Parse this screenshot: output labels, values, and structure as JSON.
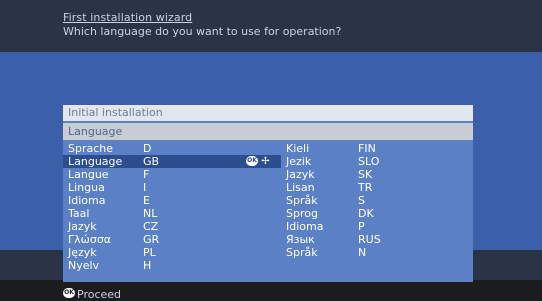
{
  "wizard": {
    "title": "First installation wizard",
    "question": "Which language do you want to use for operation?"
  },
  "panel": {
    "title": "Initial installation",
    "subtitle": "Language",
    "selected_index": 1,
    "left_items": [
      {
        "label": "Sprache",
        "code": "D"
      },
      {
        "label": "Language",
        "code": "GB"
      },
      {
        "label": "Langue",
        "code": "F"
      },
      {
        "label": "Lingua",
        "code": "I"
      },
      {
        "label": "Idioma",
        "code": "E"
      },
      {
        "label": "Taal",
        "code": "NL"
      },
      {
        "label": "Jazyk",
        "code": "CZ"
      },
      {
        "label": "Γλώσσα",
        "code": "GR"
      },
      {
        "label": "Język",
        "code": "PL"
      },
      {
        "label": "Nyelv",
        "code": "H"
      }
    ],
    "right_items": [
      {
        "label": "Kieli",
        "code": "FIN"
      },
      {
        "label": "Jezik",
        "code": "SLO"
      },
      {
        "label": "Jazyk",
        "code": "SK"
      },
      {
        "label": "Lisan",
        "code": "TR"
      },
      {
        "label": "Språk",
        "code": "S"
      },
      {
        "label": "Sprog",
        "code": "DK"
      },
      {
        "label": "Idioma",
        "code": "P"
      },
      {
        "label": "Язык",
        "code": "RUS"
      },
      {
        "label": "Språk",
        "code": "N"
      }
    ],
    "ok_badge": "OK",
    "nav_icon": "dpad-arrows-icon"
  },
  "footer": {
    "ok_badge": "OK",
    "proceed_label": "Proceed"
  },
  "colors": {
    "header_bg": "#2b3446",
    "band_blue": "#3b5fa8",
    "panel_blue": "#5b80c6",
    "selected_row": "#2c4e8e"
  }
}
